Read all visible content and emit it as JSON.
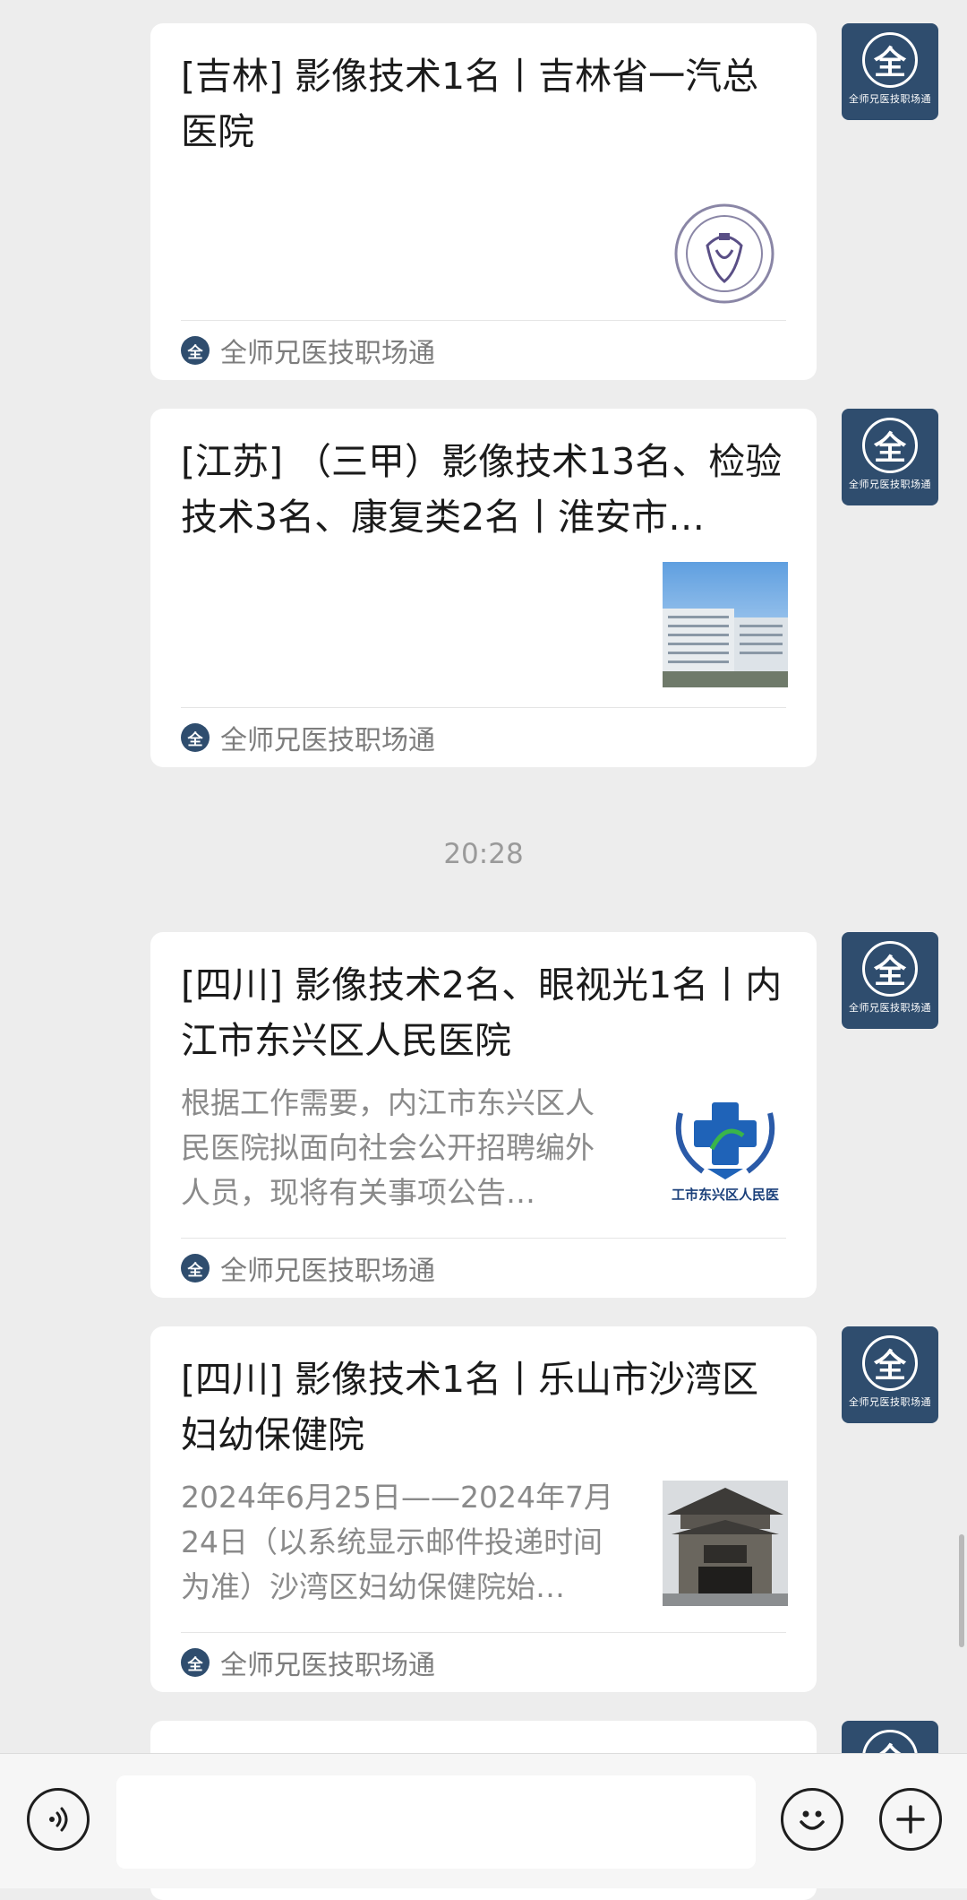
{
  "messages": [
    {
      "title": "[吉林] 影像技术1名丨吉林省一汽总医院",
      "description": "",
      "source": "全师兄医技职场通"
    },
    {
      "title": "[江苏] （三甲）影像技术13名、检验技术3名、康复类2名丨淮安市…",
      "description": "",
      "source": "全师兄医技职场通"
    },
    {
      "title": "[四川] 影像技术2名、眼视光1名丨内江市东兴区人民医院",
      "description": "根据工作需要，内江市东兴区人民医院拟面向社会公开招聘编外人员，现将有关事项公告…",
      "thumb_caption": "工市东兴区人民医",
      "source": "全师兄医技职场通"
    },
    {
      "title": "[四川] 影像技术1名丨乐山市沙湾区妇幼保健院",
      "description": "2024年6月25日——2024年7月24日（以系统显示邮件投递时间为准）沙湾区妇幼保健院始…",
      "source": "全师兄医技职场通"
    }
  ],
  "timestamp": "20:28",
  "avatar": {
    "glyph": "全",
    "caption": "全师兄医技职场通"
  },
  "footer_logo_glyph": "全",
  "bottom_bar": {
    "voice_icon": "voice-icon",
    "emoji_icon": "emoji-icon",
    "plus_icon": "plus-icon"
  },
  "colors": {
    "brand": "#2f4d6e",
    "background": "#ededed"
  }
}
